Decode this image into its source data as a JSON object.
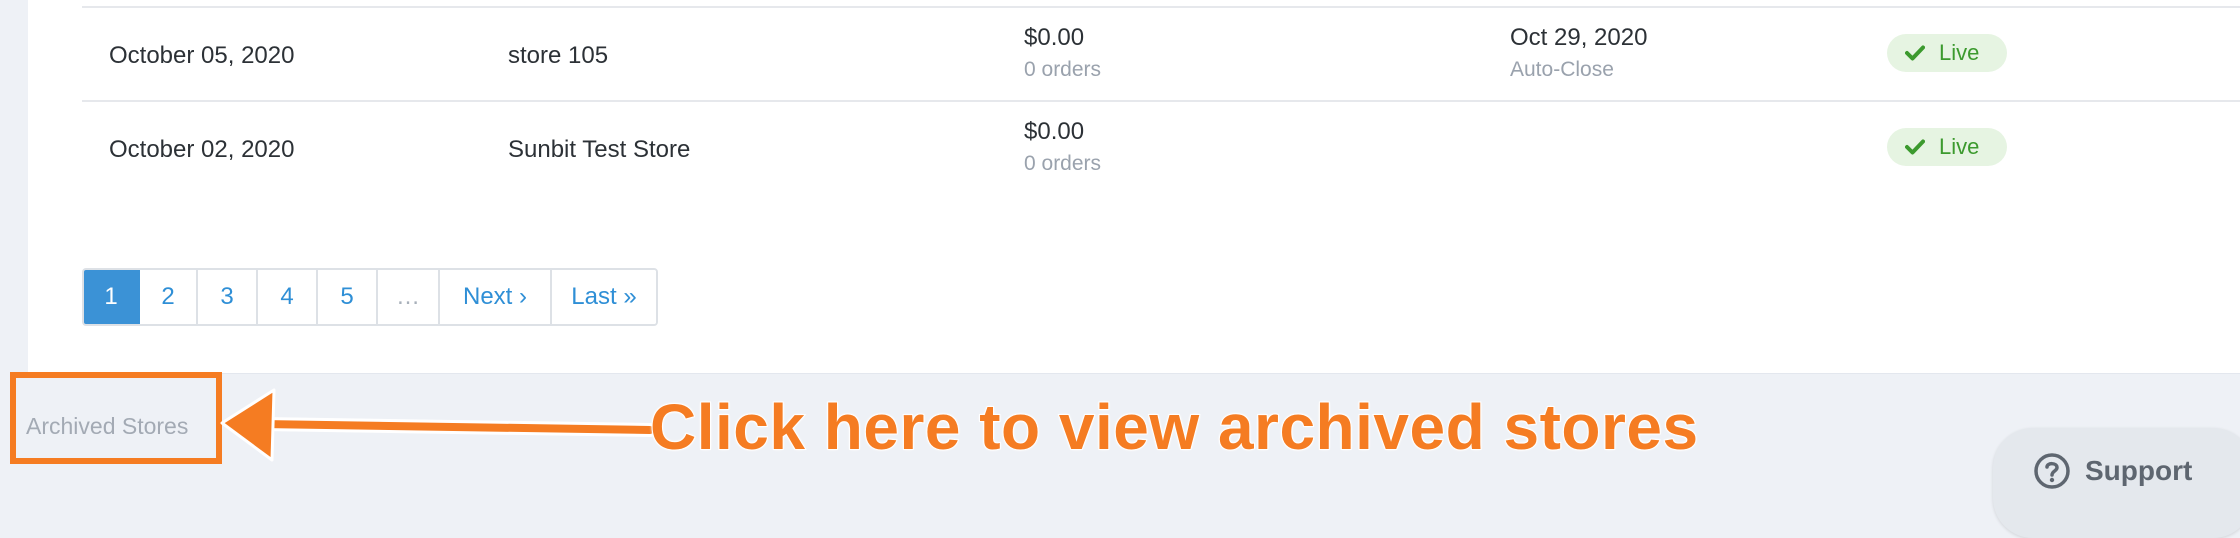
{
  "stores_table": {
    "rows": [
      {
        "created": "October 05, 2020",
        "name": "store 105",
        "amount": "$0.00",
        "orders": "0 orders",
        "close_date": "Oct 29, 2020",
        "close_note": "Auto-Close",
        "status": "Live"
      },
      {
        "created": "October 02, 2020",
        "name": "Sunbit Test Store",
        "amount": "$0.00",
        "orders": "0 orders",
        "close_date": "",
        "close_note": "",
        "status": "Live"
      }
    ]
  },
  "pagination": {
    "pages": [
      "1",
      "2",
      "3",
      "4",
      "5"
    ],
    "ellipsis": "…",
    "next": "Next ›",
    "last": "Last »",
    "current": 1
  },
  "footer": {
    "archived_link": "Archived Stores"
  },
  "annotation": {
    "callout_text": "Click here to view archived stores",
    "color": "#f57c22"
  },
  "support": {
    "label": "Support",
    "icon": "question-circle-icon"
  },
  "colors": {
    "accent": "#3b92d6",
    "live_green": "#3c9a2e",
    "live_bg": "#e6f4e2"
  }
}
